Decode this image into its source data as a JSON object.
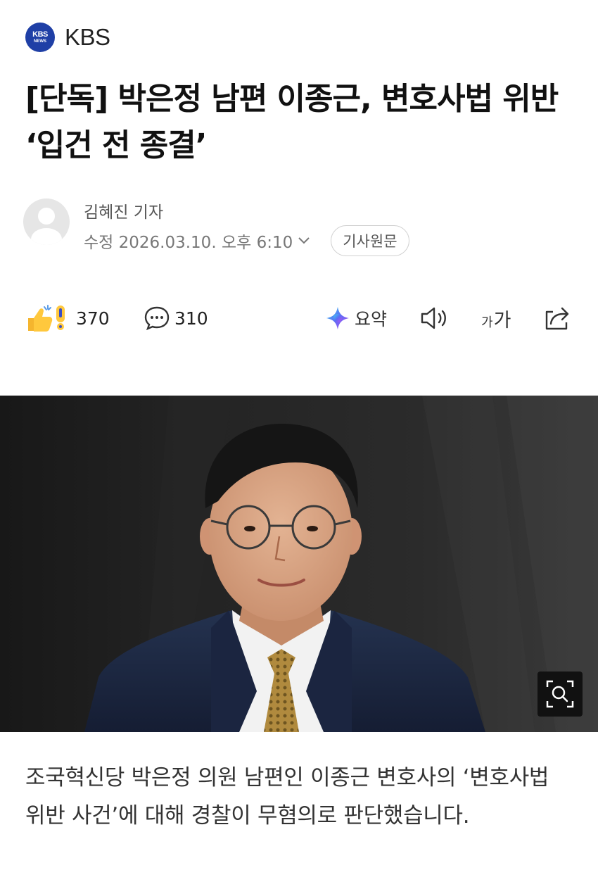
{
  "press": {
    "logo_line1": "KBS",
    "logo_line2": "NEWS",
    "name": "KBS",
    "brand_color": "#1f3fa6"
  },
  "article": {
    "headline": "[단독] 박은정 남편 이종근, 변호사법 위반 ‘입건 전 종결’",
    "author": "김혜진 기자",
    "modified": "수정 2026.03.10. 오후 6:10",
    "original_link_label": "기사원문",
    "lead": "조국혁신당 박은정 의원 남편인 이종근 변호사의 ‘변호사법 위반 사건’에 대해 경찰이 무혐의로 판단했습니다."
  },
  "toolbar": {
    "reactions_count": "370",
    "comments_count": "310",
    "summary_label": "요약",
    "font_small": "가",
    "font_large": "가"
  },
  "icons": {
    "reaction": "thumbs-up-exclaim-icon",
    "comment": "speech-bubble-icon",
    "summary": "ai-sparkle-icon",
    "listen": "speaker-icon",
    "share": "share-icon",
    "zoom": "magnifier-zoom-icon"
  }
}
